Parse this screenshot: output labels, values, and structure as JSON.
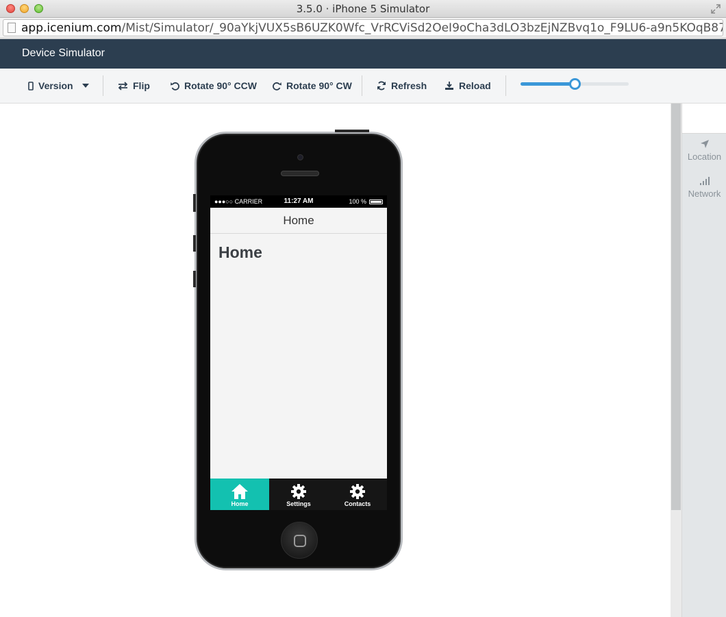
{
  "window": {
    "title": "3.5.0 · iPhone 5 Simulator",
    "url_host": "app.icenium.com",
    "url_path": "/Mist/Simulator/_90aYkjVUX5sB6UZK0Wfc_VrRCViSd2OeI9oCha3dLO3bzEjNZBvq1o_F9LU6-a9n5KOqB87dd_1Q5PA046q..."
  },
  "app": {
    "title": "Device Simulator"
  },
  "toolbar": {
    "version_label": "Version",
    "flip_label": "Flip",
    "rotate_ccw_label": "Rotate 90° CCW",
    "rotate_cw_label": "Rotate 90° CW",
    "refresh_label": "Refresh",
    "reload_label": "Reload",
    "zoom_fraction": 0.5
  },
  "sidepanel": {
    "items": [
      {
        "label": "Location",
        "icon": "location-arrow-icon"
      },
      {
        "label": "Network",
        "icon": "signal-bars-icon"
      }
    ]
  },
  "device": {
    "status": {
      "carrier": "●●●○○ CARRIER",
      "time": "11:27 AM",
      "battery": "100 %"
    },
    "navbar_title": "Home",
    "content_title": "Home",
    "tabs": [
      {
        "label": "Home",
        "icon": "home-icon",
        "active": true
      },
      {
        "label": "Settings",
        "icon": "gear-icon",
        "active": false
      },
      {
        "label": "Contacts",
        "icon": "gear-icon",
        "active": false
      }
    ]
  },
  "colors": {
    "header": "#2c3e50",
    "accent": "#3a97d8",
    "tab_active": "#13c1b0"
  }
}
